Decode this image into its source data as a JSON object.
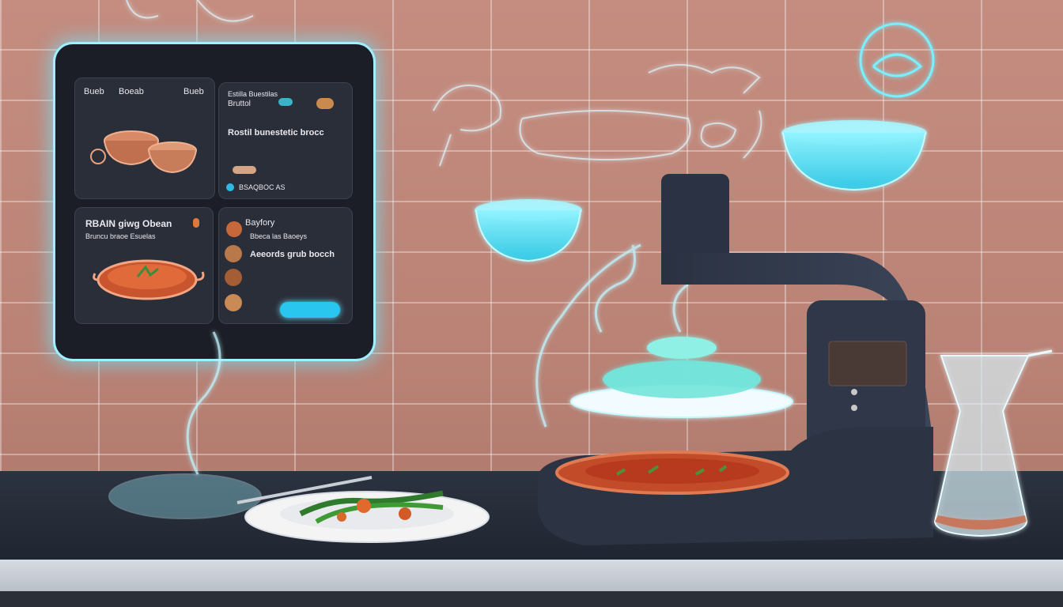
{
  "tablet": {
    "card1": {
      "tabs": [
        "Bueb",
        "Boeab",
        "Bueb"
      ]
    },
    "card2": {
      "line1": "Estilla Buestilas",
      "line2": "Bruttol",
      "headline": "Rostil bunestetic brocc",
      "footer": "BSAQBOC AS"
    },
    "card3": {
      "title": "RBAIN giwg Obean",
      "subtitle": "Bruncu braoe Esuelas"
    },
    "card4": {
      "line1": "Bayfory",
      "line2": "Bbeca las Baoeys",
      "headline": "Aeeords grub bocch"
    }
  },
  "icons": [
    "tablet-screen",
    "bowl-icon",
    "soup-icon",
    "food-thumbnail-icon",
    "hologram-bowl",
    "hologram-dish-icon",
    "water-jug"
  ],
  "colors": {
    "wall": "#c48d80",
    "hologram": "#6fe8ff",
    "counter": "#252b36",
    "machine": "#2e3646"
  }
}
